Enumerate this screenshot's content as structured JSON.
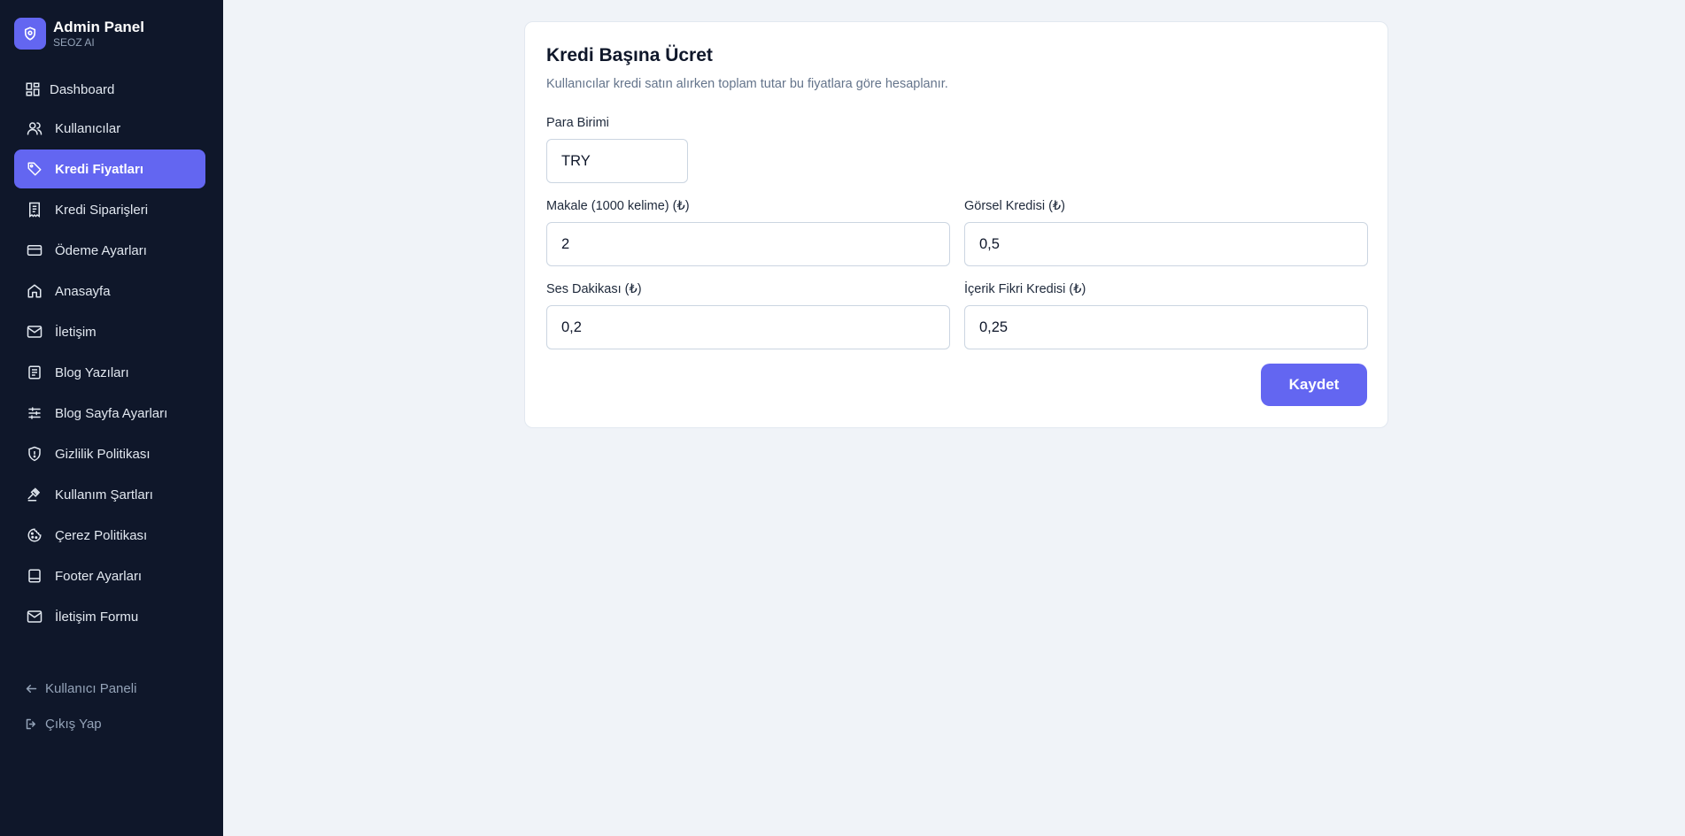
{
  "brand": {
    "title": "Admin Panel",
    "subtitle": "SEOZ AI"
  },
  "sidebar": {
    "items": [
      {
        "label": "Dashboard",
        "icon": "dashboard-icon"
      },
      {
        "label": "Kullanıcılar",
        "icon": "users-icon"
      },
      {
        "label": "Kredi Fiyatları",
        "icon": "tag-icon",
        "active": true
      },
      {
        "label": "Kredi Siparişleri",
        "icon": "receipt-icon"
      },
      {
        "label": "Ödeme Ayarları",
        "icon": "credit-card-icon"
      },
      {
        "label": "Anasayfa",
        "icon": "home-icon"
      },
      {
        "label": "İletişim",
        "icon": "mail-icon"
      },
      {
        "label": "Blog Yazıları",
        "icon": "document-icon"
      },
      {
        "label": "Blog Sayfa Ayarları",
        "icon": "sliders-icon"
      },
      {
        "label": "Gizlilik Politikası",
        "icon": "shield-icon"
      },
      {
        "label": "Kullanım Şartları",
        "icon": "gavel-icon"
      },
      {
        "label": "Çerez Politikası",
        "icon": "cookie-icon"
      },
      {
        "label": "Footer Ayarları",
        "icon": "footer-icon"
      },
      {
        "label": "İletişim Formu",
        "icon": "mail-icon"
      }
    ],
    "bottom": [
      {
        "label": "Kullanıcı Paneli",
        "icon": "arrow-left-icon"
      },
      {
        "label": "Çıkış Yap",
        "icon": "logout-icon"
      }
    ]
  },
  "card": {
    "title": "Kredi Başına Ücret",
    "description": "Kullanıcılar kredi satın alırken toplam tutar bu fiyatlara göre hesaplanır.",
    "currency": {
      "label": "Para Birimi",
      "value": "TRY"
    },
    "article": {
      "label": "Makale (1000 kelime) (₺)",
      "value": "2"
    },
    "image": {
      "label": "Görsel Kredisi (₺)",
      "value": "0,5"
    },
    "audio": {
      "label": "Ses Dakikası (₺)",
      "value": "0,2"
    },
    "idea": {
      "label": "İçerik Fikri Kredisi (₺)",
      "value": "0,25"
    },
    "save_label": "Kaydet"
  },
  "colors": {
    "sidebar_bg": "#0f172a",
    "accent": "#6366f1",
    "page_bg": "#f0f3f8"
  }
}
